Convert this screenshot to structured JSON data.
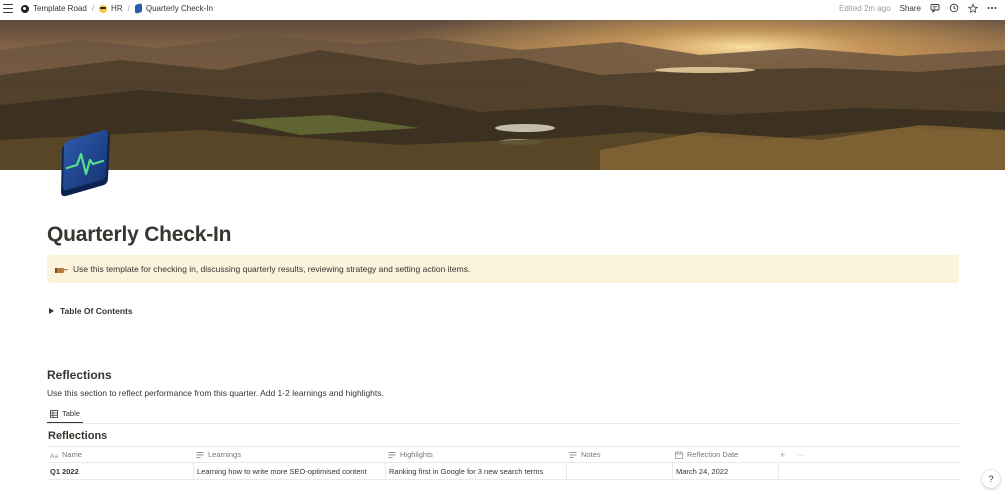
{
  "breadcrumb": {
    "items": [
      {
        "label": "Template Road",
        "icon": "template-road-logo"
      },
      {
        "label": "HR",
        "icon": "sunglasses-face-emoji"
      },
      {
        "label": "Quarterly Check-In",
        "icon": "page-mini-icon"
      }
    ],
    "separator": "/"
  },
  "topbar": {
    "edited": "Edited 2m ago",
    "share": "Share",
    "icons": [
      "comment-icon",
      "clock-icon",
      "star-icon",
      "more-icon"
    ]
  },
  "page": {
    "title": "Quarterly Check-In",
    "icon": "pulse-monitor-icon",
    "cover": "mountain-sunset-landscape"
  },
  "callout": {
    "icon": "pointing-hand-emoji",
    "text": "Use this template for checking in, discussing quarterly results, reviewing strategy and setting action items.",
    "background": "#fbf3db"
  },
  "toggle": {
    "label": "Table Of Contents"
  },
  "reflections_section": {
    "heading": "Reflections",
    "description": "Use this section to reflect performance from this quarter. Add 1-2 learnings and highlights.",
    "view_tab": "Table",
    "database_title": "Reflections",
    "columns": [
      {
        "label": "Name",
        "icon": "text-aa-icon"
      },
      {
        "label": "Learnings",
        "icon": "text-lines-icon"
      },
      {
        "label": "Highlights",
        "icon": "text-lines-icon"
      },
      {
        "label": "Notes",
        "icon": "text-lines-icon"
      },
      {
        "label": "Reflection Date",
        "icon": "calendar-icon"
      }
    ],
    "add_column": "+",
    "more": "···",
    "rows": [
      {
        "name": "Q1 2022",
        "learnings": "Learning how to write more SEO-optimised content",
        "highlights": "Ranking first in Google for 3 new search terms",
        "notes": "",
        "reflection_date": "March 24, 2022"
      }
    ]
  },
  "help": "?"
}
